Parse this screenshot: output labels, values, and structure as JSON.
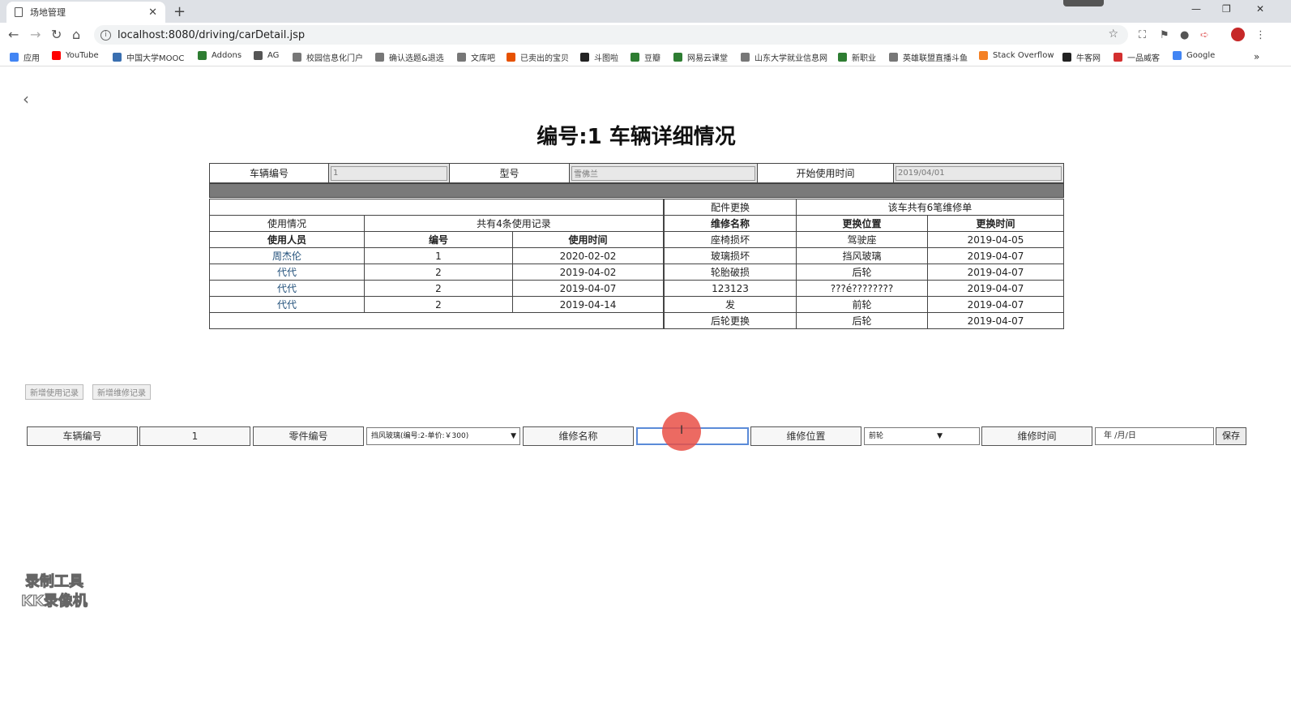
{
  "browser": {
    "tab_title": "场地管理",
    "url": "localhost:8080/driving/carDetail.jsp",
    "bookmarks": [
      "应用",
      "YouTube",
      "中国大学MOOC",
      "Addons",
      "AG",
      "校园信息化门户",
      "确认选题&退选",
      "文库吧",
      "已卖出的宝贝",
      "斗图啦",
      "豆瓣",
      "网易云课堂",
      "山东大学就业信息网",
      "新职业",
      "英雄联盟直播斗鱼",
      "Stack Overflow",
      "牛客网",
      "一品威客",
      "Google"
    ],
    "bookmark_colors": [
      "#4285f4",
      "#ff0000",
      "#3a6fb0",
      "#2e7d32",
      "#555555",
      "#777777",
      "#777777",
      "#777777",
      "#e65100",
      "#222222",
      "#2e7d32",
      "#2e7d32",
      "#777777",
      "#2e7d32",
      "#777777",
      "#f48024",
      "#222222",
      "#d32f2f",
      "#4285f4"
    ]
  },
  "page": {
    "title": "编号:1 车辆详细情况"
  },
  "car_info": {
    "id_label": "车辆编号",
    "id_value": "1",
    "model_label": "型号",
    "model_value": "雪佛兰",
    "start_label": "开始使用时间",
    "start_value": "2019/04/01"
  },
  "usage": {
    "section_label": "使用情况",
    "summary": "共有4条使用记录",
    "headers": [
      "使用人员",
      "编号",
      "使用时间"
    ],
    "rows": [
      [
        "周杰伦",
        "1",
        "2020-02-02"
      ],
      [
        "代代",
        "2",
        "2019-04-02"
      ],
      [
        "代代",
        "2",
        "2019-04-07"
      ],
      [
        "代代",
        "2",
        "2019-04-14"
      ]
    ]
  },
  "repairs": {
    "section_label": "配件更换",
    "summary": "该车共有6笔维修单",
    "headers": [
      "维修名称",
      "更换位置",
      "更换时间"
    ],
    "rows": [
      [
        "座椅损坏",
        "驾驶座",
        "2019-04-05"
      ],
      [
        "玻璃损坏",
        "挡风玻璃",
        "2019-04-07"
      ],
      [
        "轮胎破损",
        "后轮",
        "2019-04-07"
      ],
      [
        "123123",
        "???é????????",
        "2019-04-07"
      ],
      [
        "发",
        "前轮",
        "2019-04-07"
      ],
      [
        "后轮更换",
        "后轮",
        "2019-04-07"
      ]
    ]
  },
  "actions": {
    "add_usage": "新增使用记录",
    "add_repair": "新增维修记录"
  },
  "form": {
    "car_id_label": "车辆编号",
    "car_id_value": "1",
    "part_label": "零件编号",
    "part_selected": "挡风玻璃(编号:2-单价:￥300)",
    "repair_name_label": "维修名称",
    "position_label": "维修位置",
    "position_selected": "前轮",
    "time_label": "维修时间",
    "time_placeholder": "年 /月/日",
    "save": "保存"
  },
  "watermark": [
    "录制工具",
    "KK录像机"
  ]
}
